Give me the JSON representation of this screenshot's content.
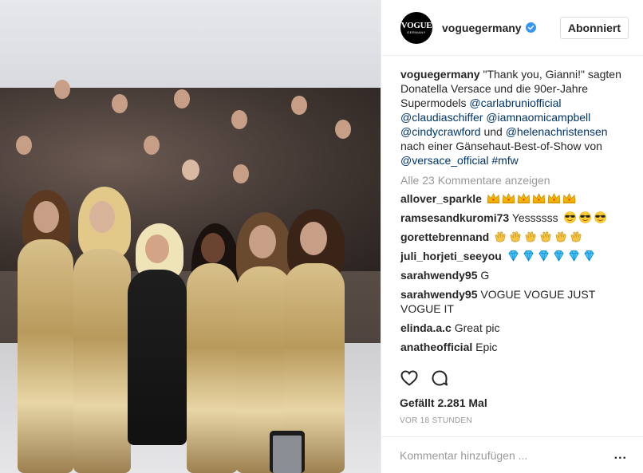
{
  "post": {
    "account": "voguegermany",
    "avatar_text": "VOGUE",
    "avatar_subtext": "GERMANY",
    "follow_label": "Abonniert",
    "caption_user": "voguegermany",
    "caption_text_1": " \"Thank you, Gianni!\" sagten Donatella Versace und die 90er-Jahre Supermodels ",
    "caption_mentions": [
      "@carlabruniofficial",
      "@claudiaschiffer",
      "@iamnaomicampbell",
      "@cindycrawford",
      "@helenachristensen",
      "@versace_official",
      "#mfw"
    ],
    "caption_und": " und ",
    "caption_text_2": " nach einer Gänsehaut-Best-of-Show von ",
    "view_all": "Alle 23 Kommentare anzeigen",
    "likes": "Gefällt 2.281 Mal",
    "time": "VOR 18 STUNDEN",
    "add_comment_placeholder": "Kommentar hinzufügen ...",
    "more_options": "..."
  },
  "comments": [
    {
      "user": "allover_sparkle",
      "text": "",
      "emoji": "crown",
      "emoji_count": 6
    },
    {
      "user": "ramsesandkuromi73",
      "text": " Yessssss ",
      "emoji": "sunglasses-face",
      "emoji_count": 3
    },
    {
      "user": "gorettebrennand",
      "text": " ",
      "emoji": "clapping-hands",
      "emoji_count": 6
    },
    {
      "user": "juli_horjeti_seeyou",
      "text": " ",
      "emoji": "gem",
      "emoji_count": 6
    },
    {
      "user": "sarahwendy95",
      "text": " G"
    },
    {
      "user": "sarahwendy95",
      "text": " VOGUE VOGUE JUST VOGUE IT"
    },
    {
      "user": "elinda.a.c",
      "text": " Great pic"
    },
    {
      "user": "anatheofficial",
      "text": " Epic"
    }
  ],
  "colors": {
    "link": "#003569",
    "muted": "#999999",
    "verified": "#3897f0",
    "border": "#efefef"
  }
}
